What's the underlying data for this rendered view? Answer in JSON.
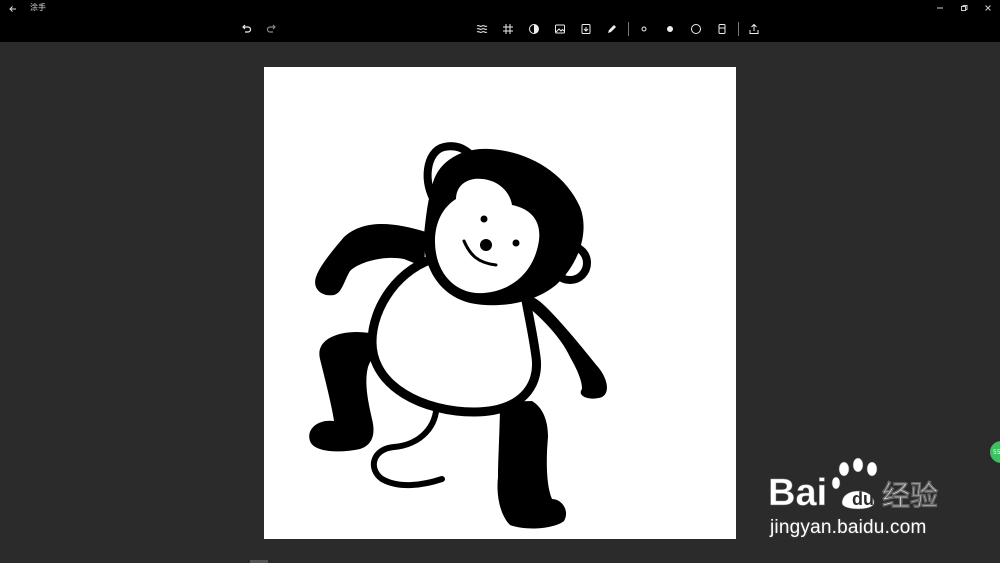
{
  "window": {
    "title": "涂手"
  },
  "toolbar": {
    "history": [
      "undo-icon",
      "redo-icon"
    ],
    "tools": [
      "texture-icon",
      "grid-icon",
      "contrast-icon",
      "image-icon",
      "import-icon",
      "pen-icon"
    ],
    "brush_sizes": [
      "small-dot-icon",
      "medium-dot-icon",
      "large-circle-icon",
      "eraser-icon"
    ],
    "share": "share-icon"
  },
  "badge": {
    "text": "55"
  },
  "watermark": {
    "logo_text": "Baidu经验",
    "url": "jingyan.baidu.com"
  },
  "colors": {
    "background": "#2b2b2b",
    "toolbar": "#000000",
    "canvas": "#ffffff",
    "badge": "#3cc060"
  }
}
